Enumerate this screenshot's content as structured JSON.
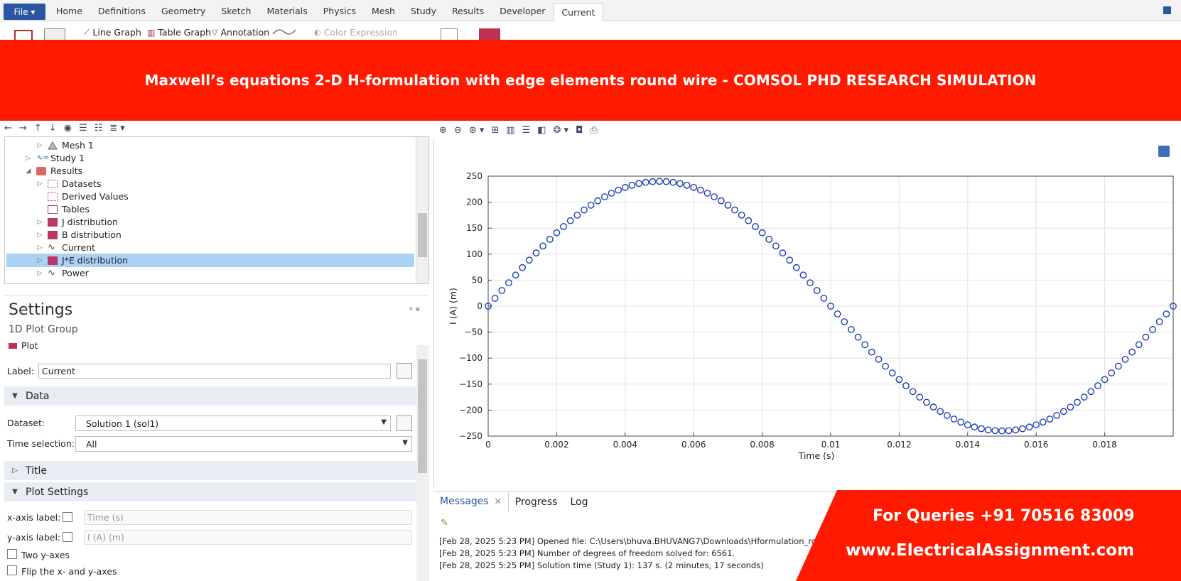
{
  "menu": {
    "file_label": "File ▾",
    "tabs": [
      "Home",
      "Definitions",
      "Geometry",
      "Sketch",
      "Materials",
      "Physics",
      "Mesh",
      "Study",
      "Results",
      "Developer",
      "Current"
    ],
    "active_tab": "Current"
  },
  "ribbon": {
    "line_graph": "Line Graph",
    "table_graph": "Table Graph",
    "annotation": "Annotation",
    "color_expression": "Color Expression"
  },
  "banner": {
    "title": "Maxwell’s equations 2-D H-formulation with edge elements round wire - COMSOL PHD RESEARCH SIMULATION",
    "color": "#ff1a00"
  },
  "tree": {
    "items": [
      {
        "label": "Mesh 1",
        "icon": "mesh-icon"
      },
      {
        "label": "Study 1",
        "icon": "study-icon"
      },
      {
        "label": "Results",
        "icon": "results-icon"
      },
      {
        "label": "Datasets",
        "icon": "datasets-icon"
      },
      {
        "label": "Derived Values",
        "icon": "derived-values-icon"
      },
      {
        "label": "Tables",
        "icon": "tables-icon"
      },
      {
        "label": "J distribution",
        "icon": "plot2d-icon"
      },
      {
        "label": "B distribution",
        "icon": "plot2d-icon"
      },
      {
        "label": "Current",
        "icon": "plot1d-icon"
      },
      {
        "label": "J*E distribution",
        "icon": "plot2d-icon"
      },
      {
        "label": "Power",
        "icon": "plot1d-icon"
      }
    ],
    "selected": "J*E distribution"
  },
  "settings": {
    "title": "Settings",
    "subtitle": "1D Plot Group",
    "plot_button": "Plot",
    "label_caption": "Label:",
    "label_value": "Current",
    "section_data": "Data",
    "dataset_caption": "Dataset:",
    "dataset_value": "Solution 1 (sol1)",
    "time_caption": "Time selection:",
    "time_value": "All",
    "section_title": "Title",
    "section_plot_settings": "Plot Settings",
    "xaxis_caption": "x-axis label:",
    "xaxis_placeholder": "Time (s)",
    "yaxis_caption": "y-axis label:",
    "yaxis_placeholder": "I (A) (m)",
    "two_y_axes": "Two y-axes",
    "flip_axes": "Flip the x- and y-axes"
  },
  "chart_data": {
    "type": "scatter",
    "xlabel": "Time (s)",
    "ylabel": "I (A) (m)",
    "xlim": [
      0,
      0.02
    ],
    "ylim": [
      -250,
      250
    ],
    "xticks": [
      "0",
      "0.002",
      "0.004",
      "0.006",
      "0.008",
      "0.01",
      "0.012",
      "0.014",
      "0.016",
      "0.018"
    ],
    "xtick_values": [
      0,
      0.002,
      0.004,
      0.006,
      0.008,
      0.01,
      0.012,
      0.014,
      0.016,
      0.018
    ],
    "yticks": [
      "250",
      "200",
      "150",
      "100",
      "50",
      "0",
      "−50",
      "−100",
      "−150",
      "−200",
      "−250"
    ],
    "ytick_values": [
      250,
      200,
      150,
      100,
      50,
      0,
      -50,
      -100,
      -150,
      -200,
      -250
    ],
    "amplitude": 240,
    "period": 0.02,
    "x_start": 0,
    "x_end": 0.02,
    "x_step": 0.0002,
    "grid": true,
    "marker_color": "#1f3fb5"
  },
  "messages": {
    "tabs": [
      "Messages",
      "Progress",
      "Log"
    ],
    "lines": [
      "[Feb 28, 2025 5:23 PM] Opened file: C:\\Users\\bhuva.BHUVANG7\\Downloads\\Hformulation_ro",
      "[Feb 28, 2025 5:23 PM] Number of degrees of freedom solved for: 6561.",
      "[Feb 28, 2025 5:25 PM] Solution time (Study 1): 137 s. (2 minutes, 17 seconds)"
    ]
  },
  "contact": {
    "phone": "For Queries +91 70516 83009",
    "website": "www.ElectricalAssignment.com",
    "color": "#ff1a00"
  }
}
